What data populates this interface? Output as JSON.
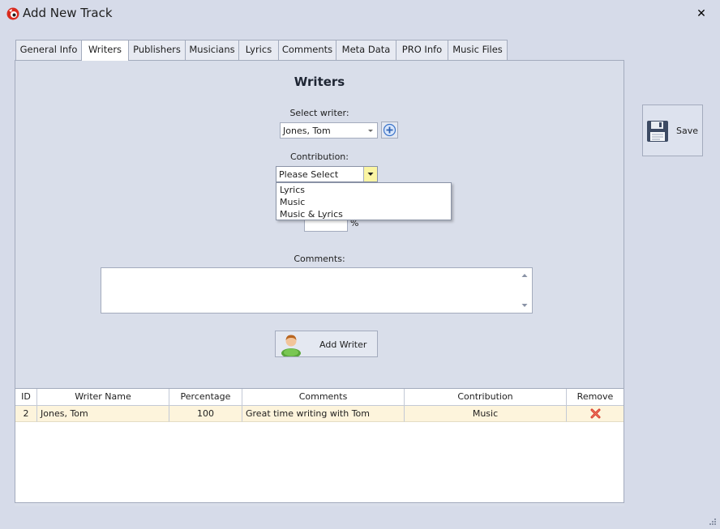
{
  "window": {
    "title": "Add New Track"
  },
  "tabs": [
    {
      "label": "General Info",
      "active": false
    },
    {
      "label": "Writers",
      "active": true
    },
    {
      "label": "Publishers",
      "active": false
    },
    {
      "label": "Musicians",
      "active": false
    },
    {
      "label": "Lyrics",
      "active": false
    },
    {
      "label": "Comments",
      "active": false
    },
    {
      "label": "Meta Data",
      "active": false
    },
    {
      "label": "PRO Info",
      "active": false
    },
    {
      "label": "Music Files",
      "active": false
    }
  ],
  "writers": {
    "section_title": "Writers",
    "select_writer_label": "Select writer:",
    "selected_writer": "Jones, Tom",
    "contribution_label": "Contribution:",
    "contribution_value": "Please Select",
    "contribution_options": [
      "Lyrics",
      "Music",
      "Music & Lyrics"
    ],
    "percent_symbol": "%",
    "comments_label": "Comments:",
    "comments_value": "",
    "add_writer_label": "Add Writer"
  },
  "grid": {
    "columns": [
      "ID",
      "Writer Name",
      "Percentage",
      "Comments",
      "Contribution",
      "Remove"
    ],
    "rows": [
      {
        "id": "2",
        "writer_name": "Jones, Tom",
        "percentage": "100",
        "comments": "Great time writing with Tom",
        "contribution": "Music"
      }
    ]
  },
  "save": {
    "label": "Save"
  },
  "icons": {
    "app": "app-logo-icon",
    "close": "close-icon",
    "add": "add-circle-icon",
    "add_writer": "user-icon",
    "save": "floppy-disk-icon",
    "remove": "red-x-icon"
  },
  "colors": {
    "window_bg": "#d6dbe9",
    "row_highlight": "#fdf4dc",
    "dropdown_arrow_active": "#fbf5a3",
    "remove_red": "#d63a2a"
  }
}
